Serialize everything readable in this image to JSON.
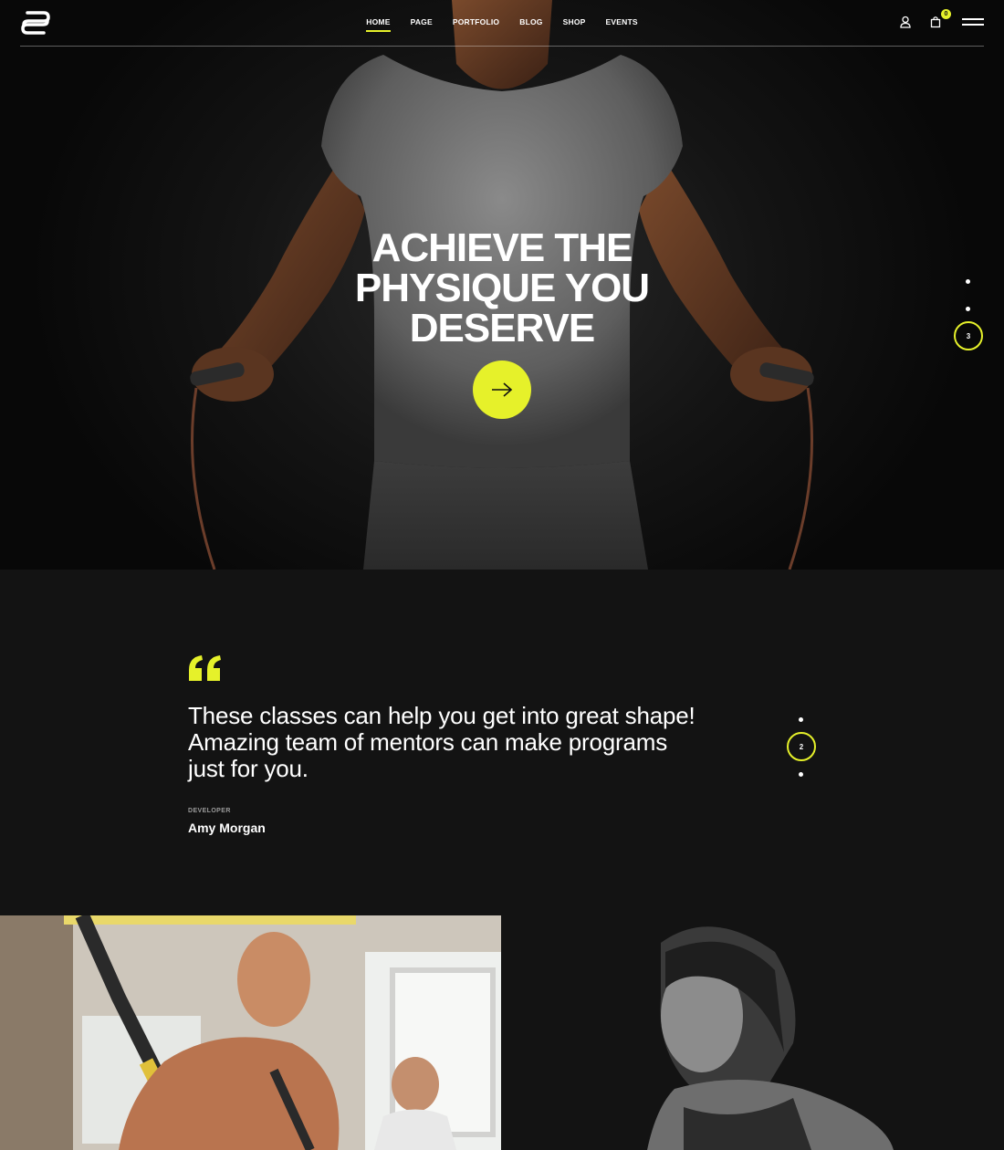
{
  "header": {
    "nav": [
      {
        "label": "HOME",
        "active": true
      },
      {
        "label": "PAGE",
        "active": false
      },
      {
        "label": "PORTFOLIO",
        "active": false
      },
      {
        "label": "BLOG",
        "active": false
      },
      {
        "label": "SHOP",
        "active": false
      },
      {
        "label": "EVENTS",
        "active": false
      }
    ],
    "cart_count": "0"
  },
  "hero": {
    "title_lines": [
      "ACHIEVE THE",
      "PHYSIQUE YOU",
      "DESERVE"
    ],
    "active_slide": "3"
  },
  "testimonial": {
    "quote": "These classes can help you get into great shape! Amazing team of mentors can make programs just for you.",
    "role": "DEVELOPER",
    "name": "Amy Morgan",
    "active_slide": "2"
  },
  "colors": {
    "accent": "#e6f12a",
    "background": "#131313"
  }
}
